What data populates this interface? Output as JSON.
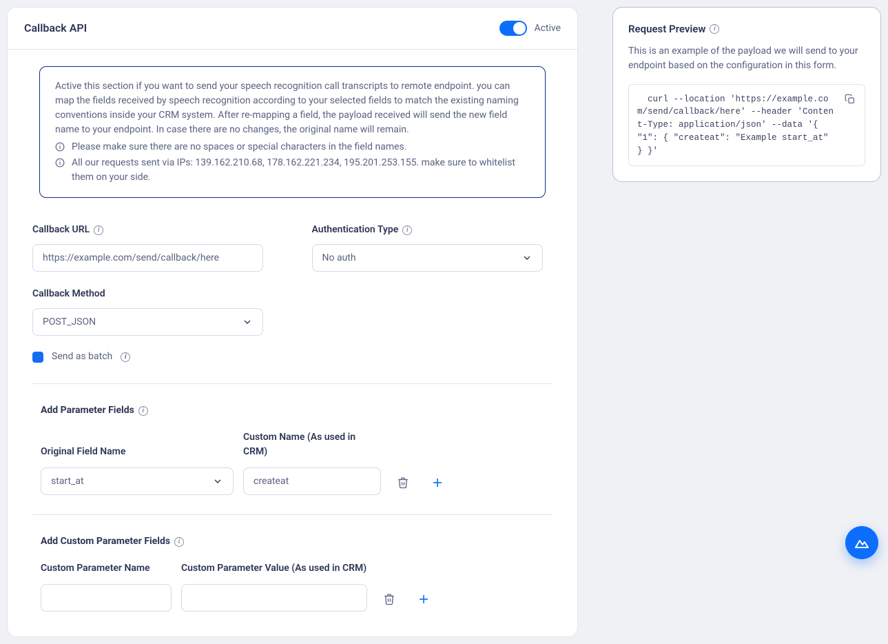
{
  "header": {
    "title": "Callback API",
    "toggle_label": "Active"
  },
  "info": {
    "paragraph": "Active this section if you want to send your speech recognition call transcripts to remote endpoint. you can map the fields received by speech recognition according to your selected fields to match the existing naming conventions inside your CRM system. After re-mapping a field, the payload received will send the new field name to your endpoint. In case there are no changes, the original name will remain.",
    "note1": "Please make sure there are no spaces or special characters in the field names.",
    "note2": "All our requests sent via IPs: 139.162.210.68, 178.162.221.234, 195.201.253.155. make sure to whitelist them on your side."
  },
  "form": {
    "callback_url_label": "Callback URL",
    "callback_url_value": "https://example.com/send/callback/here",
    "auth_type_label": "Authentication Type",
    "auth_type_value": "No auth",
    "method_label": "Callback Method",
    "method_value": "POST_JSON",
    "batch_label": "Send as batch"
  },
  "param_section": {
    "title": "Add Parameter Fields",
    "original_label": "Original Field Name",
    "custom_label": "Custom Name (As used in CRM)",
    "original_value": "start_at",
    "custom_value": "createat"
  },
  "custom_section": {
    "title": "Add Custom Parameter Fields",
    "name_label": "Custom Parameter Name",
    "value_label": "Custom Parameter Value (As used in CRM)",
    "name_value": "",
    "value_value": ""
  },
  "preview": {
    "title": "Request Preview",
    "description": "This is an example of the payload we will send to your endpoint based on the configuration in this form.",
    "code": "  curl --location 'https://example.com/send/callback/here' --header 'Content-Type: application/json' --data '{ \"1\": { \"createat\": \"Example start_at\" } }'"
  }
}
